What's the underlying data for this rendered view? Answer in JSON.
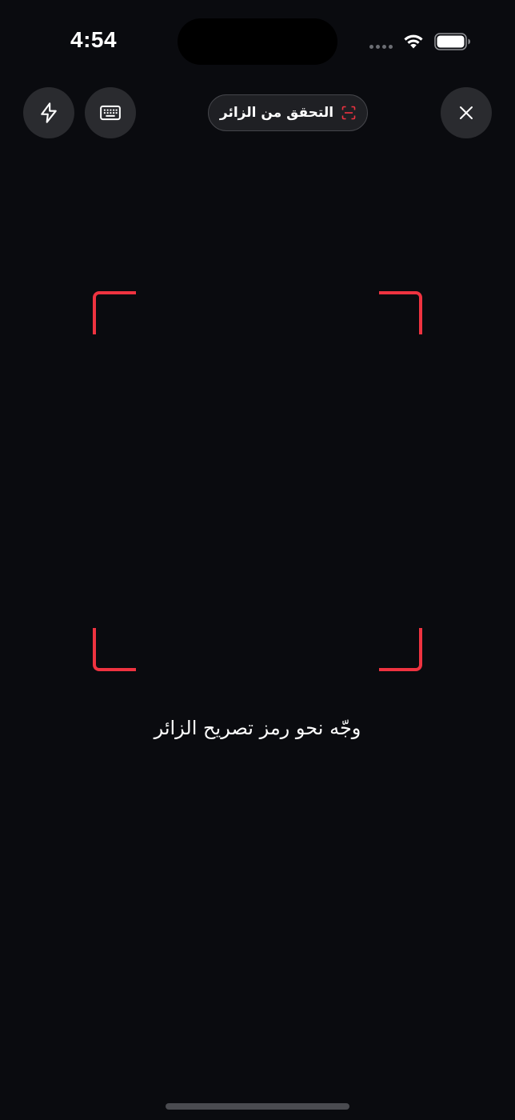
{
  "status_bar": {
    "time": "4:54",
    "icons": [
      "cellular-signal-icon",
      "wifi-icon",
      "battery-icon"
    ]
  },
  "toolbar": {
    "flash_icon": "lightning-bolt-icon",
    "keyboard_icon": "keyboard-icon",
    "close_icon": "close-icon",
    "mode_pill": {
      "label": "التحقق من الزائر",
      "icon": "scan-frame-icon"
    }
  },
  "scanner": {
    "instruction": "وجّه نحو رمز تصريح الزائر"
  },
  "colors": {
    "background": "#0a0b0f",
    "accent": "#ef3340",
    "button": "#2a2b2f",
    "text": "#ffffff"
  }
}
